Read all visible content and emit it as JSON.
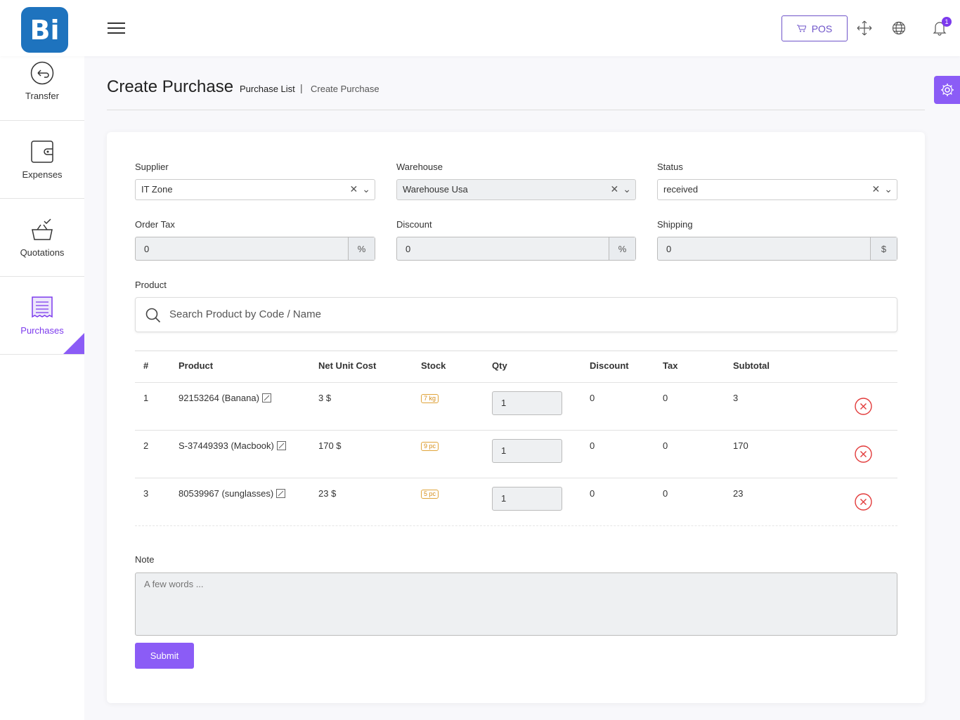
{
  "header": {
    "logo_text": "Bi",
    "pos_label": "POS",
    "notification_count": "1",
    "accent_color": "#8b5cf6"
  },
  "sidebar": {
    "items": [
      {
        "label": "Transfer",
        "icon": "transfer-icon"
      },
      {
        "label": "Expenses",
        "icon": "wallet-icon"
      },
      {
        "label": "Quotations",
        "icon": "basket-icon"
      },
      {
        "label": "Purchases",
        "icon": "receipt-icon",
        "active": true
      }
    ]
  },
  "page": {
    "title": "Create Purchase",
    "breadcrumb": [
      "Purchase List",
      "Create Purchase"
    ],
    "breadcrumb_sep": "|"
  },
  "form": {
    "supplier_label": "Supplier",
    "supplier_value": "IT Zone",
    "warehouse_label": "Warehouse",
    "warehouse_value": "Warehouse Usa",
    "status_label": "Status",
    "status_value": "received",
    "order_tax_label": "Order Tax",
    "order_tax_value": "0",
    "order_tax_unit": "%",
    "discount_label": "Discount",
    "discount_value": "0",
    "discount_unit": "%",
    "shipping_label": "Shipping",
    "shipping_value": "0",
    "shipping_unit": "$",
    "product_label": "Product",
    "search_placeholder": "Search Product by Code / Name",
    "note_label": "Note",
    "note_placeholder": "A few words ...",
    "submit_label": "Submit"
  },
  "table": {
    "headers": [
      "#",
      "Product",
      "Net Unit Cost",
      "Stock",
      "Qty",
      "Discount",
      "Tax",
      "Subtotal"
    ],
    "rows": [
      {
        "num": "1",
        "product": "92153264 (Banana)",
        "cost": "3 $",
        "stock": "7 kg",
        "qty": "1",
        "discount": "0",
        "tax": "0",
        "subtotal": "3"
      },
      {
        "num": "2",
        "product": "S-37449393 (Macbook)",
        "cost": "170 $",
        "stock": "9 pc",
        "qty": "1",
        "discount": "0",
        "tax": "0",
        "subtotal": "170"
      },
      {
        "num": "3",
        "product": "80539967 (sunglasses)",
        "cost": "23 $",
        "stock": "5 pc",
        "qty": "1",
        "discount": "0",
        "tax": "0",
        "subtotal": "23"
      }
    ]
  }
}
